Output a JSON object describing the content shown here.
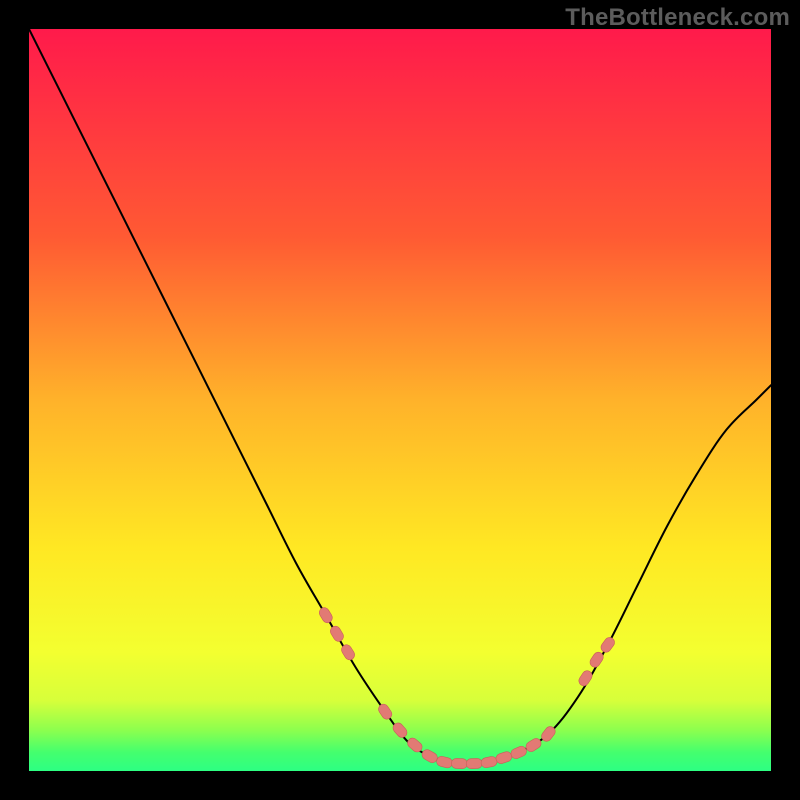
{
  "watermark": "TheBottleneck.com",
  "colors": {
    "black": "#000000",
    "curve": "#000000",
    "marker_fill": "#e27a74",
    "marker_stroke": "#c95f59",
    "grad_top": "#ff1a4b",
    "grad_q1": "#ff7e2a",
    "grad_mid": "#ffe823",
    "grad_q3": "#e6ff33",
    "grad_low": "#a6ff4d",
    "grad_bottom": "#2dff83"
  },
  "chart_data": {
    "type": "line",
    "title": "",
    "xlabel": "",
    "ylabel": "",
    "xlim": [
      0,
      100
    ],
    "ylim": [
      0,
      100
    ],
    "grid": false,
    "series": [
      {
        "name": "bottleneck-curve",
        "x": [
          0,
          4,
          8,
          12,
          16,
          20,
          24,
          28,
          32,
          36,
          40,
          44,
          48,
          51,
          54,
          57,
          60,
          63,
          66,
          70,
          74,
          78,
          82,
          86,
          90,
          94,
          98,
          100
        ],
        "y": [
          100,
          92,
          84,
          76,
          68,
          60,
          52,
          44,
          36,
          28,
          21,
          14,
          8,
          4,
          2,
          1,
          1,
          1.5,
          2.5,
          5,
          10,
          17,
          25,
          33,
          40,
          46,
          50,
          52
        ]
      }
    ],
    "markers": {
      "name": "highlight-points",
      "x": [
        40,
        41.5,
        43,
        48,
        50,
        52,
        54,
        56,
        58,
        60,
        62,
        64,
        66,
        68,
        70,
        75,
        76.5,
        78
      ],
      "y": [
        21,
        18.5,
        16,
        8,
        5.5,
        3.5,
        2,
        1.2,
        1,
        1,
        1.2,
        1.8,
        2.5,
        3.5,
        5,
        12.5,
        15,
        17
      ]
    }
  }
}
